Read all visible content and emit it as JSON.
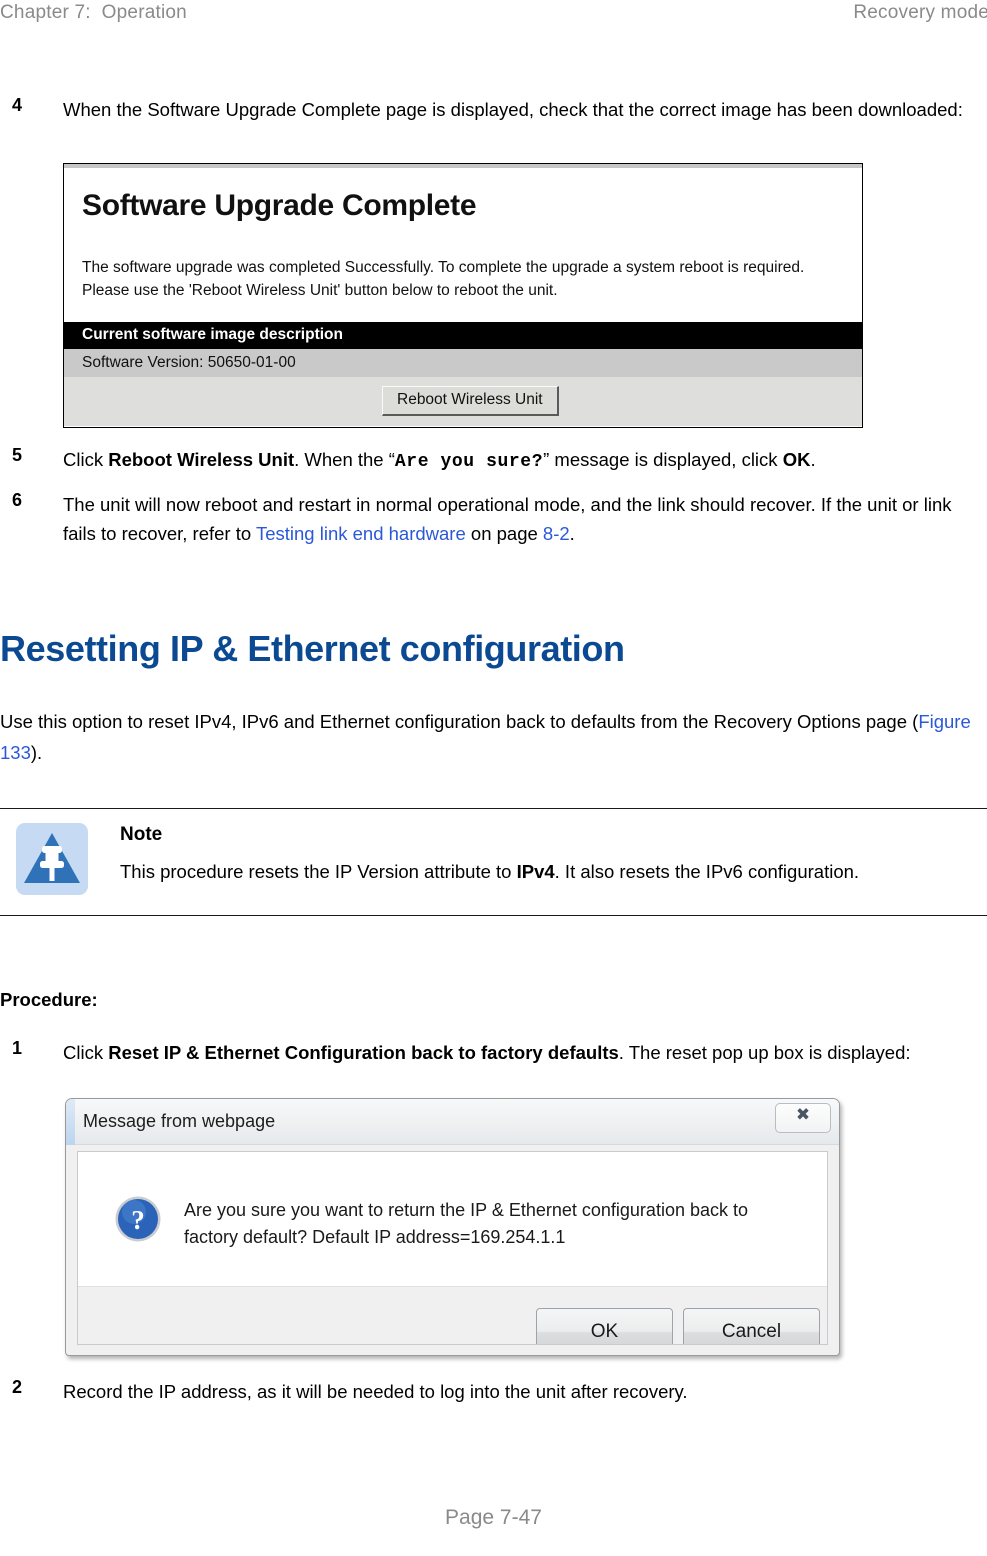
{
  "runhead": {
    "left": "Chapter 7:  Operation",
    "right": "Recovery mode"
  },
  "steps": {
    "step4": {
      "number": "4",
      "text": "When the Software Upgrade Complete page is displayed, check that the correct image has been downloaded:"
    },
    "step5": {
      "number": "5",
      "lead": "Click ",
      "bold1": "Reboot Wireless Unit",
      "mid1": ". When the “",
      "mono": "Are you sure?",
      "mid2": "” message is displayed, click ",
      "bold2": "OK",
      "tail": "."
    },
    "step6": {
      "number": "6",
      "line1": "The unit will now reboot and restart in normal operational mode, and the link should recover. If the unit or link fails to recover, refer to ",
      "link_text": "Testing link end hardware",
      "mid": " on page ",
      "link_page": "8-2",
      "tail": "."
    },
    "proc1": {
      "number": "1",
      "lead": "Click ",
      "bold": "Reset IP & Ethernet Configuration back to factory defaults",
      "tail": ". The reset pop up box is displayed:"
    },
    "proc2": {
      "number": "2",
      "text": "Record the IP address, as it will be needed to log into the unit after recovery."
    }
  },
  "software_upgrade_figure": {
    "title": "Software Upgrade Complete",
    "paragraph": "The software upgrade was completed Successfully. To complete the upgrade a system reboot is required. Please use the 'Reboot Wireless Unit' button below to reboot the unit.",
    "section_bar": "Current software image description",
    "version_row": "Software Version: 50650-01-00",
    "button_label": "Reboot Wireless Unit"
  },
  "heading": {
    "title": "Resetting IP & Ethernet configuration"
  },
  "intro": {
    "lead": "Use this option to reset IPv4, IPv6 and Ethernet configuration back to defaults from the Recovery Options page (",
    "link": "Figure 133",
    "tail": ")."
  },
  "note": {
    "title": "Note",
    "lead": "This procedure resets the IP Version attribute to ",
    "bold": "IPv4",
    "tail": ". It also resets the IPv6 configuration.",
    "icon_bg_color": "#c6daf4",
    "icon_fill_color": "#2f72b8"
  },
  "procedure": {
    "label": "Procedure:"
  },
  "dialog": {
    "title": "Message from webpage",
    "close_glyph": "✖",
    "message": "Are you sure you want to return the IP & Ethernet configuration back to factory default? Default IP address=169.254.1.1",
    "ok_label": "OK",
    "cancel_label": "Cancel"
  },
  "footer": {
    "folio": "Page 7-47"
  },
  "colors": {
    "heading_blue": "#0b4a92",
    "link_blue": "#2b58d8",
    "runhead_gray": "#8a8a8a"
  }
}
